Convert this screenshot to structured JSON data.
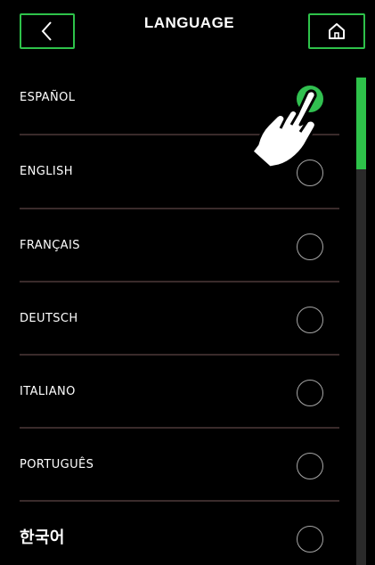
{
  "header": {
    "title": "LANGUAGE",
    "back_icon": "chevron-left-icon",
    "home_icon": "home-icon"
  },
  "colors": {
    "accent": "#2ec24a",
    "background": "#000000",
    "divider": "#3a2b2b",
    "radio_outline": "#a7a7a7"
  },
  "languages": [
    {
      "label": "ESPAÑOL",
      "selected": true
    },
    {
      "label": "ENGLISH",
      "selected": false
    },
    {
      "label": "FRANÇAIS",
      "selected": false
    },
    {
      "label": "DEUTSCH",
      "selected": false
    },
    {
      "label": "ITALIANO",
      "selected": false
    },
    {
      "label": "PORTUGUÊS",
      "selected": false
    },
    {
      "label": "한국어",
      "selected": false
    }
  ],
  "overlay": {
    "icon": "pointing-hand-icon"
  }
}
